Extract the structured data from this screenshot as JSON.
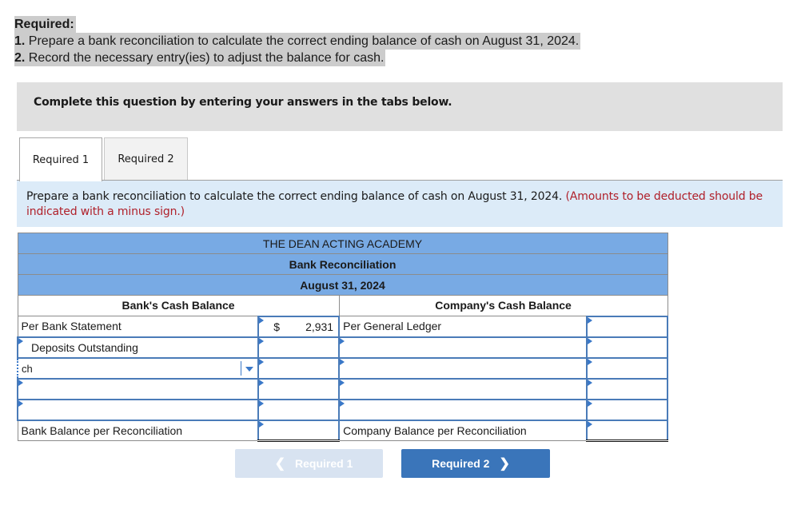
{
  "required": {
    "title": "Required:",
    "items": [
      {
        "num": "1.",
        "text": " Prepare a bank reconciliation to calculate the correct ending balance of cash on August 31, 2024."
      },
      {
        "num": "2.",
        "text": " Record the necessary entry(ies) to adjust the balance for cash."
      }
    ]
  },
  "instructions": "Complete this question by entering your answers in the tabs below.",
  "tabs": [
    {
      "label": "Required 1",
      "active": true
    },
    {
      "label": "Required 2",
      "active": false
    }
  ],
  "prompt": {
    "text": "Prepare a bank reconciliation to calculate the correct ending balance of cash on August 31, 2024. ",
    "note": "(Amounts to be deducted should be indicated with a minus sign.)"
  },
  "reconciliation": {
    "company": "THE DEAN ACTING ACADEMY",
    "title": "Bank Reconciliation",
    "date": "August 31, 2024",
    "bank_header": "Bank's Cash Balance",
    "company_header": "Company's Cash Balance",
    "bank_rows": [
      {
        "label": "Per Bank Statement",
        "currency": "$",
        "amount": "2,931"
      },
      {
        "label": "Deposits Outstanding",
        "amount": ""
      },
      {
        "label": "ch",
        "amount": "",
        "dropdown": true
      },
      {
        "label": "",
        "amount": ""
      },
      {
        "label": "",
        "amount": ""
      }
    ],
    "bank_total_label": "Bank Balance per Reconciliation",
    "bank_total_value": "",
    "company_rows": [
      {
        "label": "Per General Ledger",
        "amount": ""
      },
      {
        "label": "",
        "amount": ""
      },
      {
        "label": "",
        "amount": ""
      },
      {
        "label": "",
        "amount": ""
      },
      {
        "label": "",
        "amount": ""
      }
    ],
    "company_total_label": "Company Balance per Reconciliation",
    "company_total_value": ""
  },
  "navigation": {
    "prev_label": "Required 1",
    "next_label": "Required 2",
    "prev_icon": "chevron-left-icon",
    "next_icon": "chevron-right-icon"
  }
}
